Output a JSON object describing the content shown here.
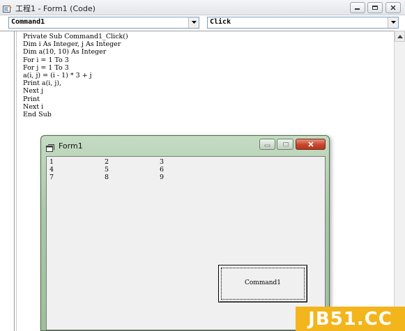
{
  "code_window": {
    "title": "工程1 - Form1 (Code)",
    "object_combo": "Command1",
    "procedure_combo": "Click",
    "code_lines": [
      "Private Sub Command1_Click()",
      "Dim i As Integer, j As Integer",
      "Dim a(10, 10) As Integer",
      "For i = 1 To 3",
      "For j = 1 To 3",
      "a(i, j) = (i - 1) * 3 + j",
      "Print a(i, j),",
      "Next j",
      "Print",
      "Next i",
      "End Sub"
    ]
  },
  "form1": {
    "title": "Form1",
    "output_rows": [
      [
        "1",
        "2",
        "3"
      ],
      [
        "4",
        "5",
        "6"
      ],
      [
        "7",
        "8",
        "9"
      ]
    ],
    "button_label": "Command1"
  },
  "watermark": {
    "text": "JB51.CC"
  },
  "colors": {
    "form_frame": "#a9c8a7",
    "close_button": "#c9452c",
    "watermark_bg": "#f3b51c"
  }
}
